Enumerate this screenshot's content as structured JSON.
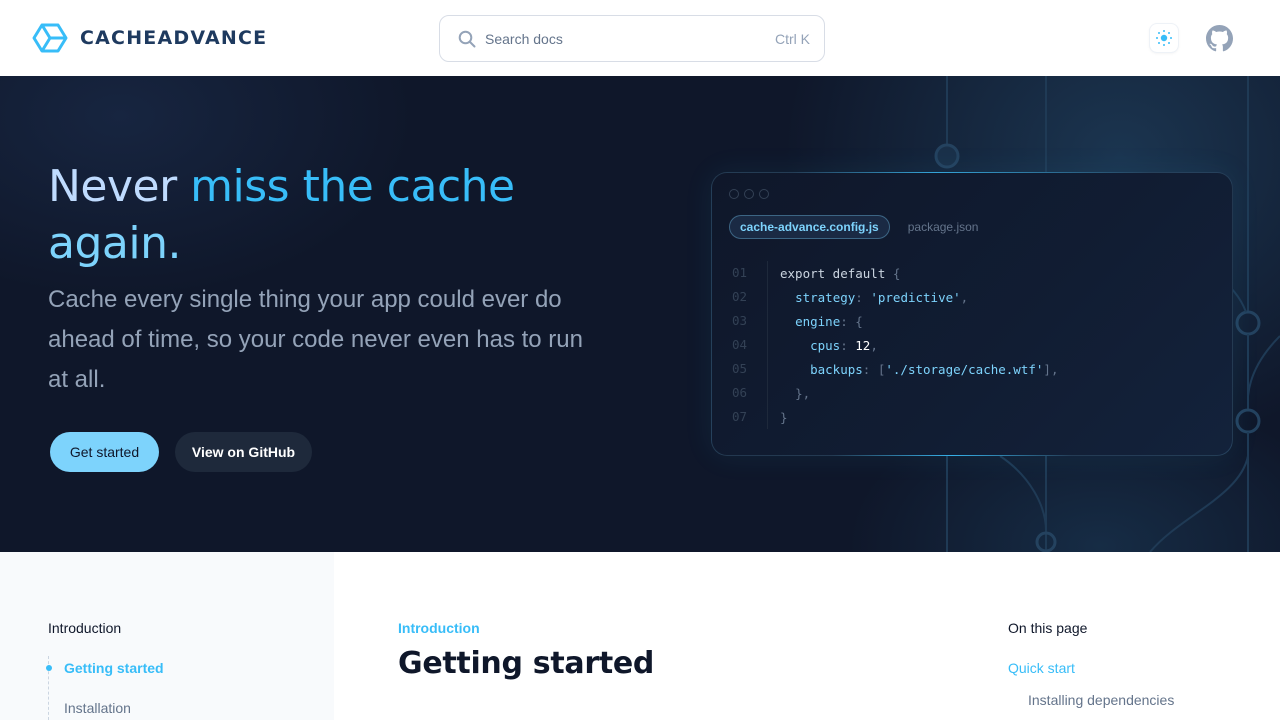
{
  "header": {
    "brand": "CACHEADVANCE",
    "logo_icon": "hexagon-cube-icon",
    "search": {
      "placeholder": "Search docs",
      "shortcut": "Ctrl K",
      "icon": "search-icon"
    },
    "theme_toggle_icon": "sun-icon",
    "github_icon": "github-icon"
  },
  "hero": {
    "title_part1": "Never ",
    "title_part2": "miss the cache",
    "title_part3": "again.",
    "subtitle": "Cache every single thing your app could ever do ahead of time, so your code never even has to run at all.",
    "primary_button": "Get started",
    "secondary_button": "View on GitHub"
  },
  "code_panel": {
    "tabs": [
      {
        "label": "cache-advance.config.js",
        "active": true
      },
      {
        "label": "package.json",
        "active": false
      }
    ],
    "lines": [
      {
        "num": "01"
      },
      {
        "num": "02"
      },
      {
        "num": "03"
      },
      {
        "num": "04"
      },
      {
        "num": "05"
      },
      {
        "num": "06"
      },
      {
        "num": "07"
      }
    ],
    "code": {
      "l1_kw": "export default ",
      "l1_p": "{",
      "l2_k": "strategy",
      "l2_p1": ": ",
      "l2_s": "'predictive'",
      "l2_p2": ",",
      "l3_k": "engine",
      "l3_p1": ": ",
      "l3_p2": "{",
      "l4_k": "cpus",
      "l4_p1": ": ",
      "l4_n": "12",
      "l4_p2": ",",
      "l5_k": "backups",
      "l5_p1": ": [",
      "l5_s": "'./storage/cache.wtf'",
      "l5_p2": "],",
      "l6_p": "},",
      "l7_p": "}"
    }
  },
  "sidebar": {
    "section": "Introduction",
    "items": [
      {
        "label": "Getting started",
        "active": true
      },
      {
        "label": "Installation",
        "active": false
      }
    ]
  },
  "main": {
    "eyebrow": "Introduction",
    "title": "Getting started"
  },
  "toc": {
    "title": "On this page",
    "items": [
      {
        "label": "Quick start",
        "level": 1
      },
      {
        "label": "Installing dependencies",
        "level": 2
      }
    ]
  },
  "colors": {
    "accent": "#38bdf8",
    "accent_light": "#7dd3fc",
    "hero_bg": "#0f172a",
    "brand_text": "#1e3a5f"
  }
}
